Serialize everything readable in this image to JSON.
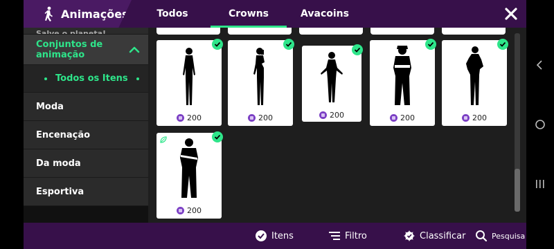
{
  "header": {
    "section_title": "Animações",
    "tabs": [
      {
        "label": "Todos",
        "active": false
      },
      {
        "label": "Crowns",
        "active": true
      },
      {
        "label": "Avacoins",
        "active": false
      }
    ]
  },
  "sidebar": {
    "cut_item": "Salve o planeta!",
    "group_label": "Conjuntos de animação",
    "sub_item": "Todos os Itens",
    "items": [
      "Moda",
      "Encenação",
      "Da moda",
      "Esportiva"
    ]
  },
  "grid": {
    "cards": [
      {
        "price": "200",
        "owned": true,
        "figure": "figure-female-icon"
      },
      {
        "price": "200",
        "owned": true,
        "figure": "figure-female-phone-icon"
      },
      {
        "price": "200",
        "owned": true,
        "figure": "figure-female-icon"
      },
      {
        "price": "200",
        "owned": true,
        "figure": "figure-male-cap-icon"
      },
      {
        "price": "200",
        "owned": true,
        "figure": "figure-female-hands-hips-icon"
      },
      {
        "price": "200",
        "owned": true,
        "figure": "figure-male-arms-crossed-icon",
        "eco_badge": true
      }
    ]
  },
  "bottombar": {
    "items_label": "Itens",
    "filter_label": "Filtro",
    "sort_label": "Classificar",
    "search_label": "Pesquisa"
  },
  "colors": {
    "header_bg": "#37104a",
    "accent_green": "#2ee58a",
    "coin_purple": "#7b3fc4"
  }
}
